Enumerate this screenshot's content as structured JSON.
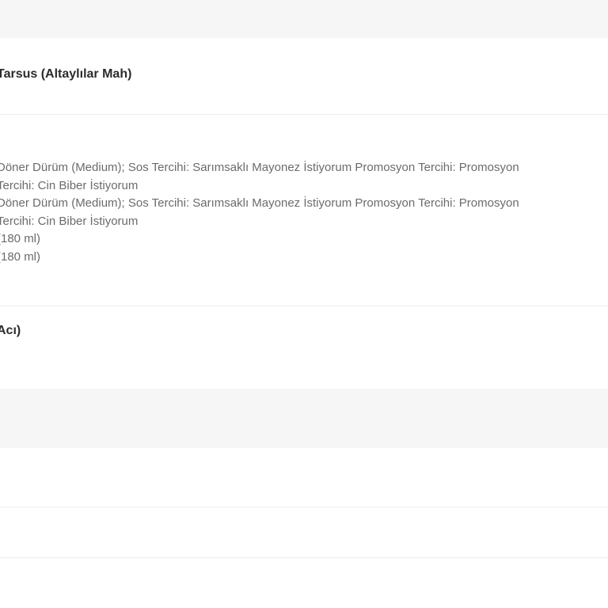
{
  "order": {
    "restaurant": "Tarsus (Altaylılar Mah)",
    "items": [
      "Döner Dürüm (Medium); Sos Tercihi: Sarımsaklı Mayonez İstiyorum Promosyon Tercihi: Promosyon",
      "Tercihi: Cin Biber İstiyorum",
      "Döner Dürüm (Medium); Sos Tercihi: Sarımsaklı Mayonez İstiyorum Promosyon Tercihi: Promosyon",
      "Tercihi: Cin Biber İstiyorum",
      "(180 ml)",
      "(180 ml)"
    ],
    "note": "Acı)"
  }
}
